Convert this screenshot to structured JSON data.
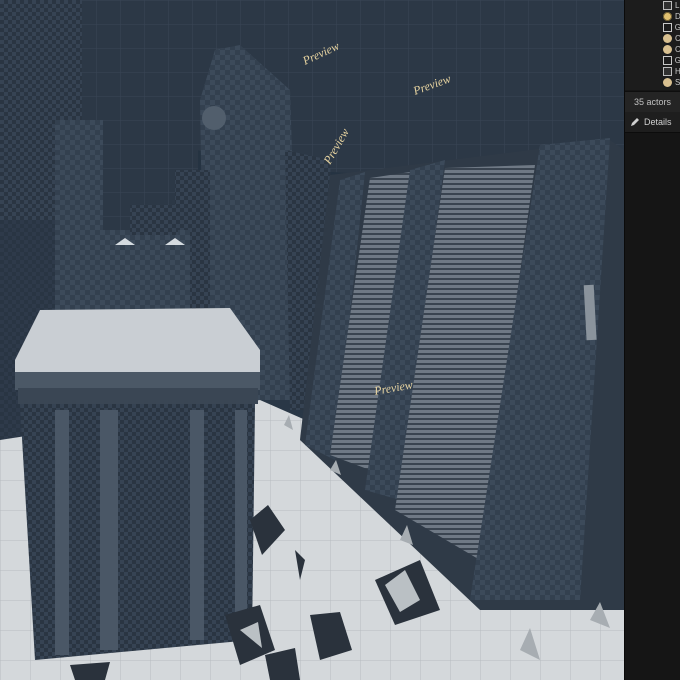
{
  "viewport": {
    "watermark": "Preview",
    "colors": {
      "sky": "#2b3c4f",
      "building_dark": "#2f3b49",
      "building_mid": "#3e4b5a",
      "ground": "#d9dde0",
      "roof": "#c9ced3"
    }
  },
  "outliner": {
    "rows": [
      {
        "icon": "cube-icon",
        "label": "L"
      },
      {
        "icon": "light-icon",
        "label": "D"
      },
      {
        "icon": "image-icon",
        "label": "G"
      },
      {
        "icon": "sphere-icon",
        "label": "C"
      },
      {
        "icon": "sphere-icon",
        "label": "C"
      },
      {
        "icon": "image-icon",
        "label": "G"
      },
      {
        "icon": "cube-icon",
        "label": "H"
      },
      {
        "icon": "sphere-icon",
        "label": "S"
      }
    ]
  },
  "actor_count": "35 actors",
  "details": {
    "tab_label": "Details"
  }
}
